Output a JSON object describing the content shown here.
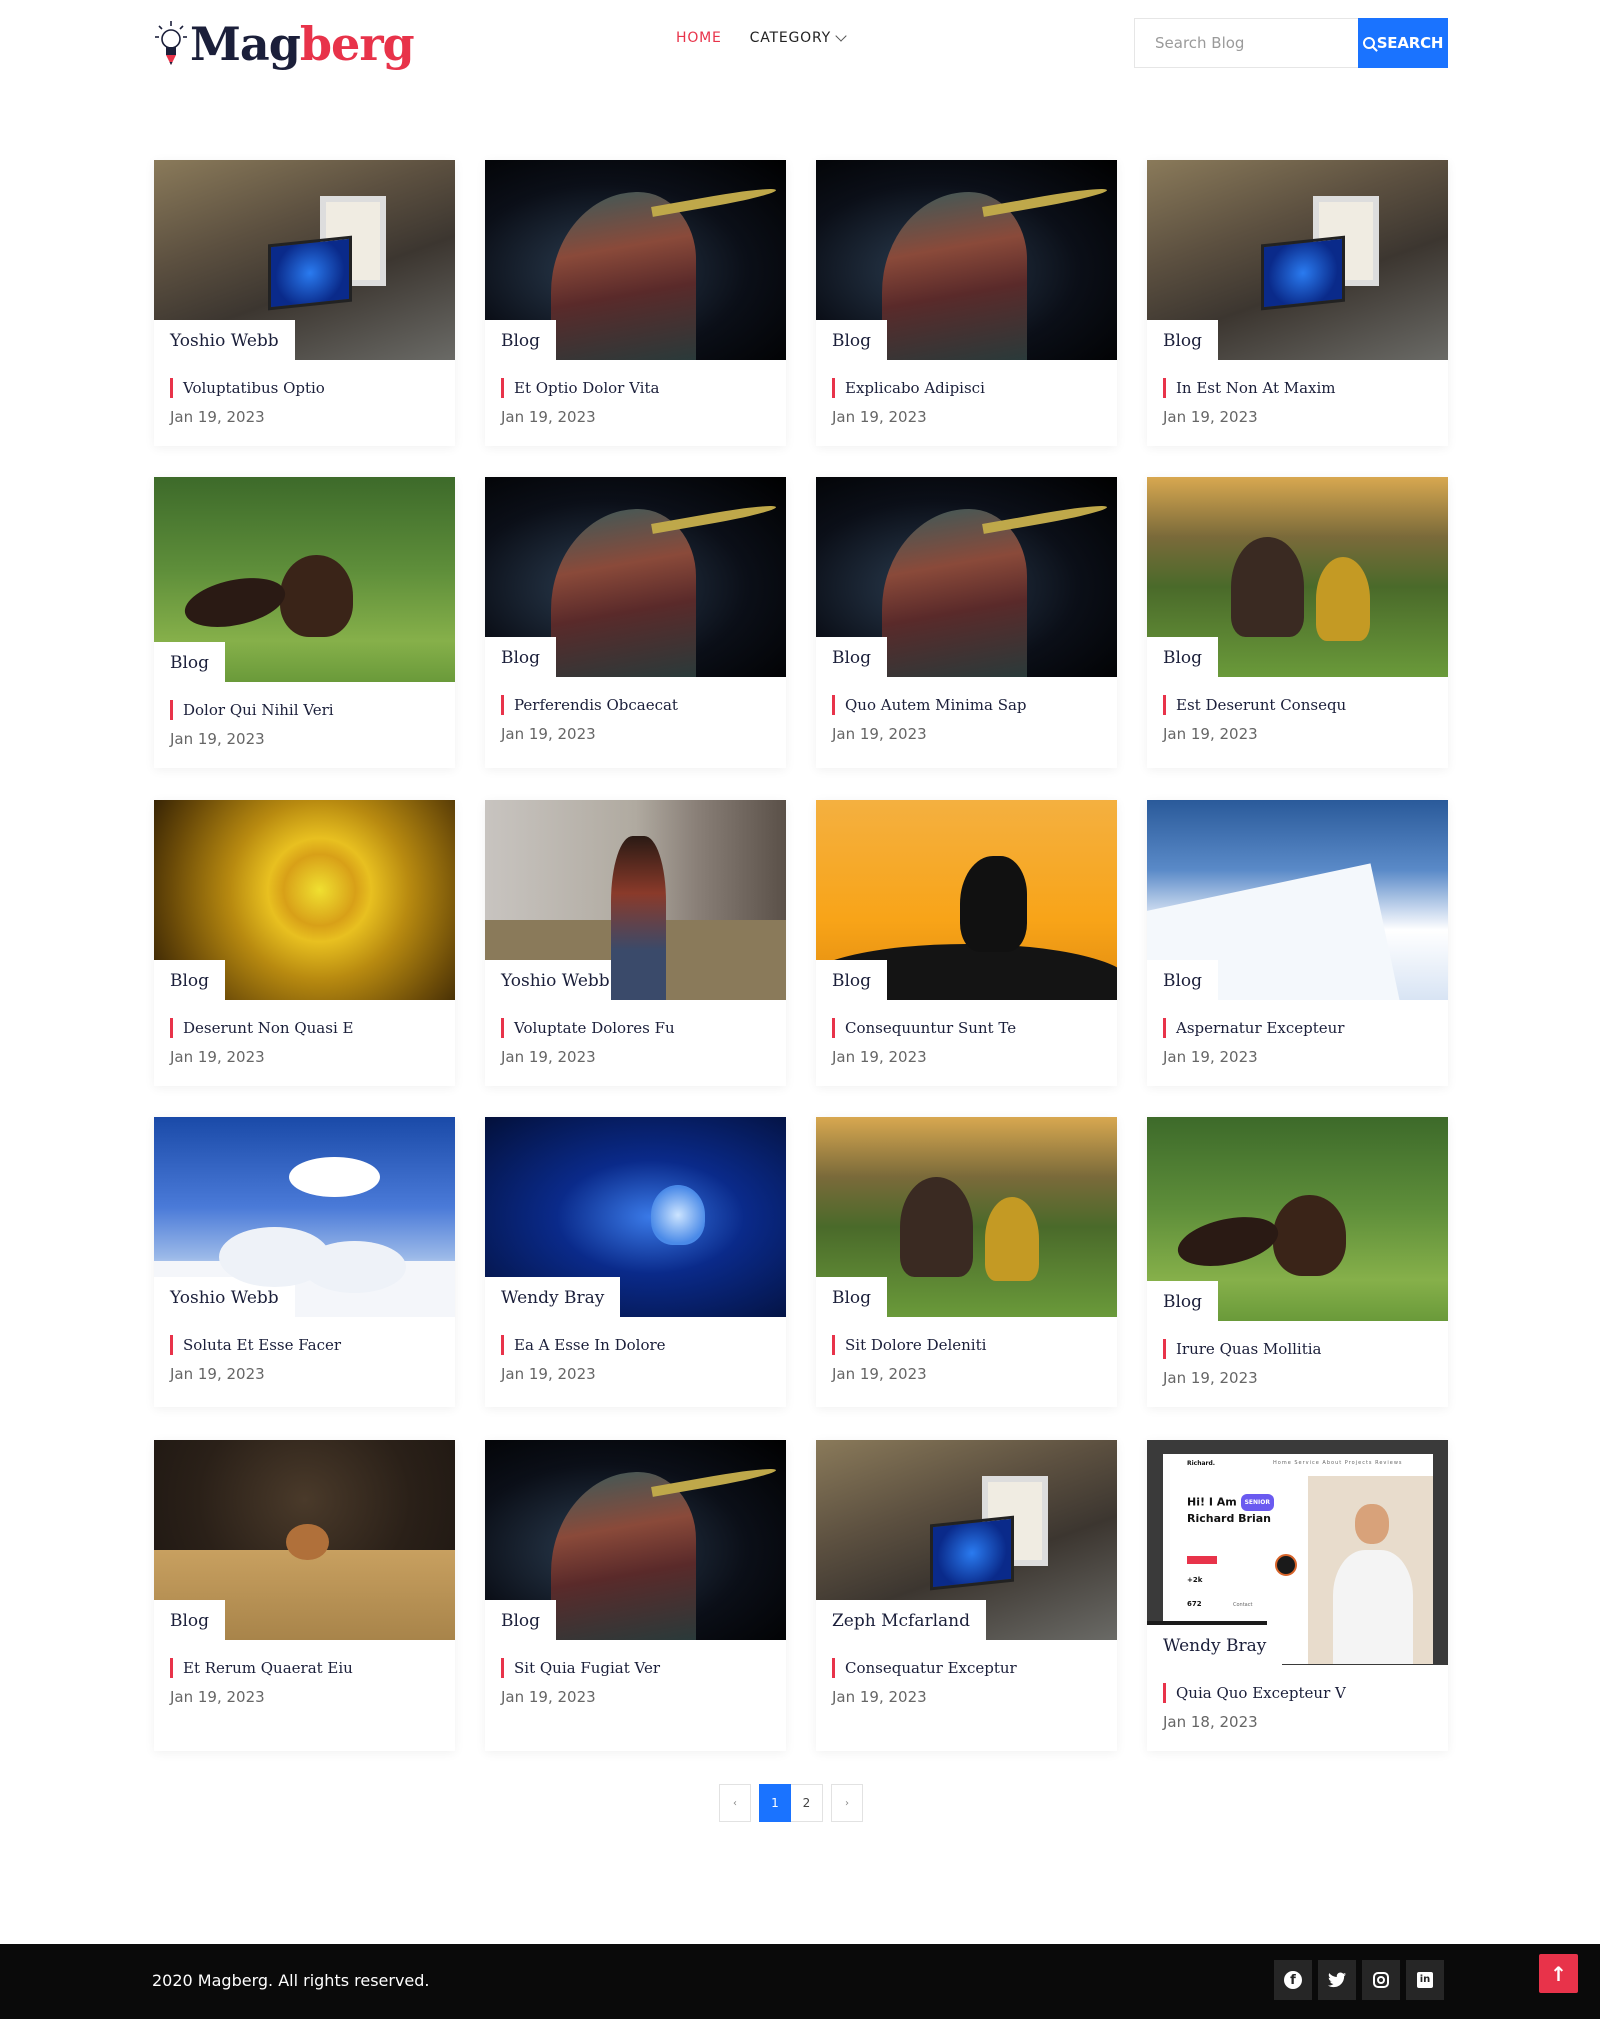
{
  "brand": {
    "name_a": "Mag",
    "name_b": "berg",
    "color_dark": "#1b1f3a",
    "color_accent": "#e8334a"
  },
  "nav": {
    "home": "HOME",
    "category": "CATEGORY"
  },
  "search": {
    "placeholder": "Search Blog",
    "button_label": "SEARCH",
    "button_color": "#1a73ff"
  },
  "posts": [
    {
      "tag": "Yoshio Webb",
      "title": "Voluptatibus Optio",
      "date": "Jan 19, 2023",
      "image": "desk"
    },
    {
      "tag": "Blog",
      "title": "Et Optio Dolor Vita",
      "date": "Jan 19, 2023",
      "image": "bird"
    },
    {
      "tag": "Blog",
      "title": "Explicabo Adipisci",
      "date": "Jan 19, 2023",
      "image": "bird"
    },
    {
      "tag": "Blog",
      "title": "In Est Non At Maxim",
      "date": "Jan 19, 2023",
      "image": "desk"
    },
    {
      "tag": "Blog",
      "title": "Dolor Qui Nihil Veri",
      "date": "Jan 19, 2023",
      "image": "squirrel"
    },
    {
      "tag": "Blog",
      "title": "Perferendis Obcaecat",
      "date": "Jan 19, 2023",
      "image": "bird"
    },
    {
      "tag": "Blog",
      "title": "Quo Autem Minima Sap",
      "date": "Jan 19, 2023",
      "image": "bird"
    },
    {
      "tag": "Blog",
      "title": "Est Deserunt Consequ",
      "date": "Jan 19, 2023",
      "image": "girls"
    },
    {
      "tag": "Blog",
      "title": "Deserunt Non Quasi E",
      "date": "Jan 19, 2023",
      "image": "flower"
    },
    {
      "tag": "Yoshio Webb",
      "title": "Voluptate Dolores Fu",
      "date": "Jan 19, 2023",
      "image": "woman"
    },
    {
      "tag": "Blog",
      "title": "Consequuntur Sunt Te",
      "date": "Jan 19, 2023",
      "image": "gull"
    },
    {
      "tag": "Blog",
      "title": "Aspernatur Excepteur",
      "date": "Jan 19, 2023",
      "image": "snowmtn"
    },
    {
      "tag": "Yoshio Webb",
      "title": "Soluta Et Esse Facer",
      "date": "Jan 19, 2023",
      "image": "snowtree"
    },
    {
      "tag": "Wendy Bray",
      "title": "Ea A Esse In Dolore",
      "date": "Jan 19, 2023",
      "image": "jelly"
    },
    {
      "tag": "Blog",
      "title": "Sit Dolore Deleniti",
      "date": "Jan 19, 2023",
      "image": "girls"
    },
    {
      "tag": "Blog",
      "title": "Irure Quas Mollitia",
      "date": "Jan 19, 2023",
      "image": "squirrel"
    },
    {
      "tag": "Blog",
      "title": "Et Rerum Quaerat Eiu",
      "date": "Jan 19, 2023",
      "image": "hoopoe"
    },
    {
      "tag": "Blog",
      "title": "Sit Quia Fugiat Ver",
      "date": "Jan 19, 2023",
      "image": "bird"
    },
    {
      "tag": "Zeph Mcfarland",
      "title": "Consequatur Exceptur",
      "date": "Jan 19, 2023",
      "image": "desk"
    },
    {
      "tag": "Wendy Bray",
      "title": "Quia Quo Excepteur V",
      "date": "Jan 18, 2023",
      "image": "portfolio"
    }
  ],
  "portfolio_mock": {
    "brand": "Richard.",
    "nav": "Home  Service  About  Projects  Reviews",
    "greeting": "Hi! I Am",
    "badge": "SENIOR",
    "name": "Richard Brian",
    "stat_a": "+2k",
    "stat_b": "672",
    "contact": "Contact"
  },
  "pagination": {
    "prev": "‹",
    "next": "›",
    "pages": [
      "1",
      "2"
    ],
    "current": "1"
  },
  "footer": {
    "copyright": "2020 Magberg. All rights reserved.",
    "facebook": "f",
    "linkedin": "in",
    "totop": "↑"
  }
}
